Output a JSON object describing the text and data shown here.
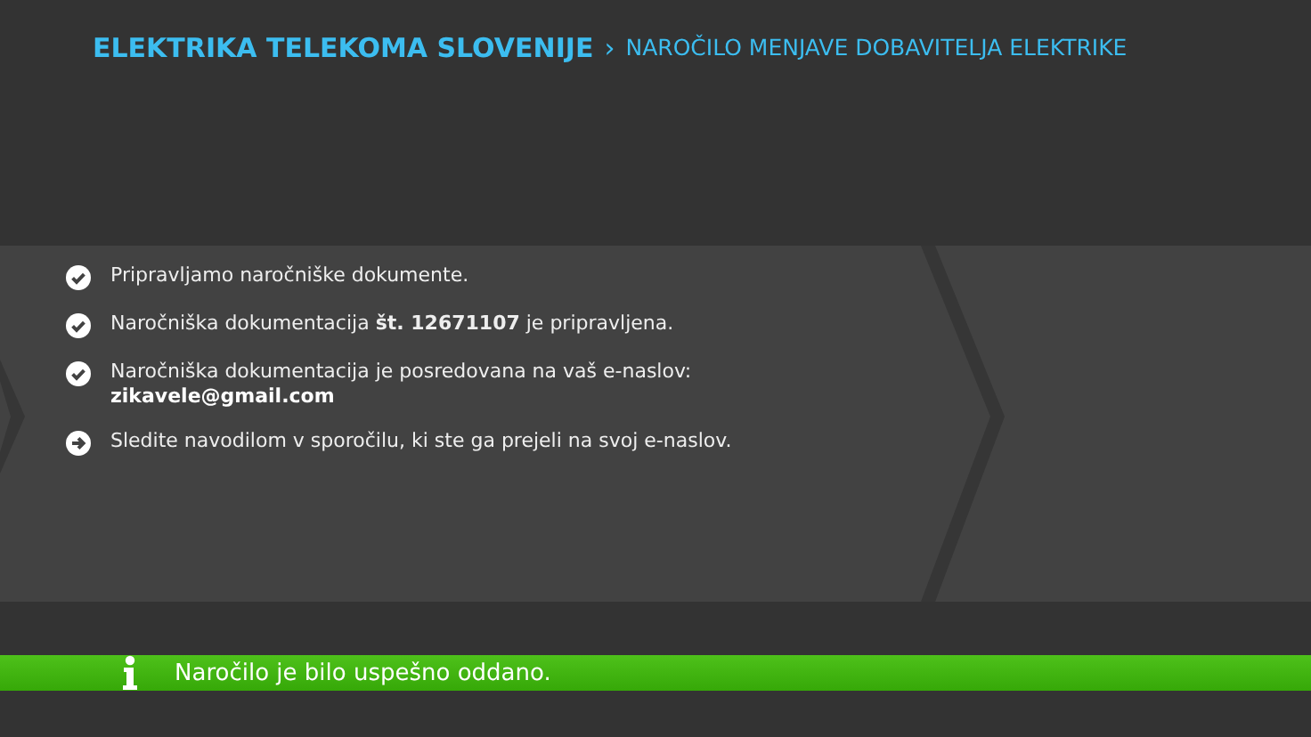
{
  "header": {
    "brand": "ELEKTRIKA TELEKOMA SLOVENIJE",
    "separator": "›",
    "page": "NAROČILO MENJAVE DOBAVITELJA ELEKTRIKE"
  },
  "steps": [
    {
      "kind": "done",
      "text": "Pripravljamo naročniške dokumente."
    },
    {
      "kind": "done",
      "text": "Naročniška dokumentacija **št. 12671107** je pripravljena."
    },
    {
      "kind": "done",
      "text": "Naročniška dokumentacija je posredovana na vaš e-naslov:",
      "detail": "zikavele@gmail.com"
    },
    {
      "kind": "next",
      "text": "Sledite navodilom v sporočilu, ki ste ga prejeli na svoj e-naslov."
    }
  ],
  "notification": {
    "text": "Naročilo je bilo uspešno oddano."
  }
}
